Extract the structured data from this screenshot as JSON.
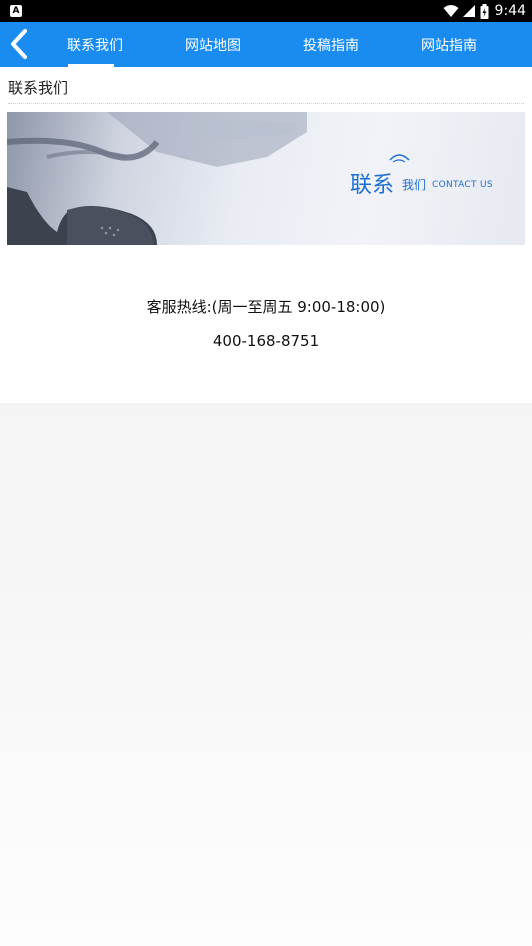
{
  "status_bar": {
    "notification_letter": "A",
    "time": "9:44"
  },
  "nav": {
    "tabs": [
      {
        "label": "联系我们",
        "active": true
      },
      {
        "label": "网站地图",
        "active": false
      },
      {
        "label": "投稿指南",
        "active": false
      },
      {
        "label": "网站指南",
        "active": false
      }
    ]
  },
  "content": {
    "section_title": "联系我们",
    "banner": {
      "title": "联系",
      "subtitle": "我们",
      "english": "CONTACT US"
    },
    "hotline": "客服热线:(周一至周五 9:00-18:00)",
    "phone": "400-168-8751"
  },
  "colors": {
    "nav_blue": "#1a8cf0",
    "banner_text": "#1c70d4"
  },
  "icons": [
    "back-arrow-icon",
    "wifi-icon",
    "signal-icon",
    "battery-icon",
    "notification-icon",
    "phone-handset-icon"
  ]
}
